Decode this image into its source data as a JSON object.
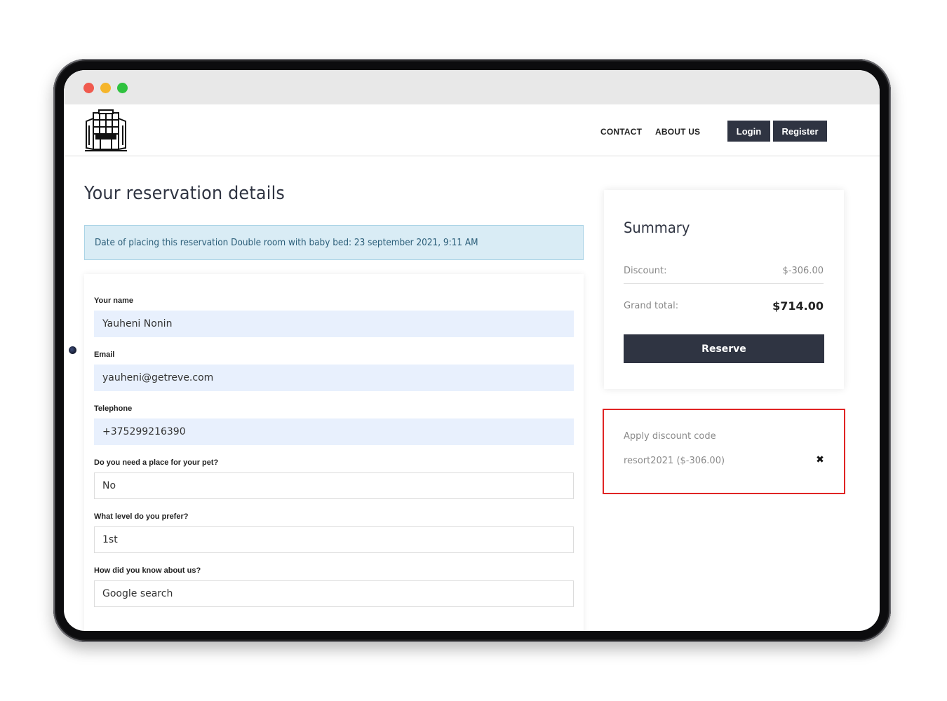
{
  "nav": {
    "contact": "CONTACT",
    "about": "ABOUT US",
    "login": "Login",
    "register": "Register"
  },
  "page": {
    "title": "Your reservation details",
    "alert": "Date of placing this reservation Double room with baby bed: 23 september 2021, 9:11 AM"
  },
  "form": {
    "fields": [
      {
        "label": "Your name",
        "value": "Yauheni Nonin"
      },
      {
        "label": "Email",
        "value": "yauheni@getreve.com"
      },
      {
        "label": "Telephone",
        "value": "+375299216390"
      },
      {
        "label": "Do you need a place for your pet?",
        "value": "No"
      },
      {
        "label": "What level do you prefer?",
        "value": "1st"
      },
      {
        "label": "How did you know about us?",
        "value": "Google search"
      }
    ]
  },
  "summary": {
    "title": "Summary",
    "discount_label": "Discount:",
    "discount_value": "$-306.00",
    "grand_label": "Grand total:",
    "grand_value": "$714.00",
    "reserve_label": "Reserve"
  },
  "discount_code": {
    "title": "Apply discount code",
    "code": "resort2021 ($-306.00)",
    "remove_icon": "close-icon"
  },
  "colors": {
    "dark": "#2f3442",
    "highlight_border": "#e02424",
    "alert_bg": "#d9ecf5",
    "input_filled_bg": "#e8f0fd"
  }
}
